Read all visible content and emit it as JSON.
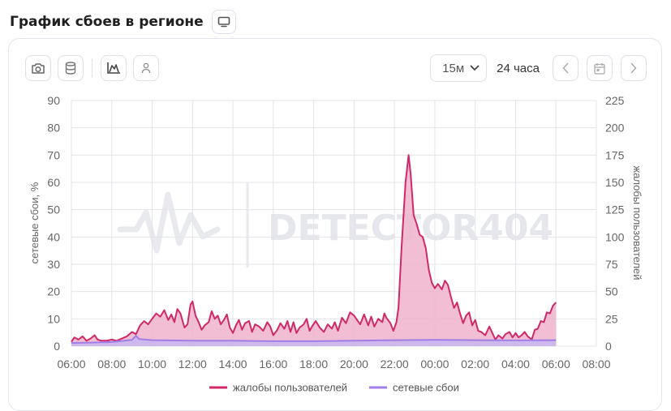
{
  "header": {
    "title": "График сбоев в регионе",
    "screen_icon": "monitor-icon"
  },
  "toolbar": {
    "icons": [
      "camera-icon",
      "database-icon",
      "chart-mode-icon",
      "user-icon"
    ],
    "interval_value": "15м",
    "range_label": "24 часа",
    "prev_icon": "chevron-left-icon",
    "calendar_icon": "calendar-icon",
    "next_icon": "chevron-right-icon"
  },
  "watermark": "DETECTOR404",
  "chart_data": {
    "type": "area",
    "title": "",
    "ylabel_left": "сетевые сбои, %",
    "ylabel_right": "жалобы пользователей",
    "y_left_lim": [
      0,
      90
    ],
    "y_right_lim": [
      0,
      225
    ],
    "y_left_ticks": [
      "0",
      "10",
      "20",
      "30",
      "40",
      "50",
      "60",
      "70",
      "80",
      "90"
    ],
    "y_right_ticks": [
      "0",
      "25",
      "50",
      "75",
      "100",
      "125",
      "150",
      "175",
      "200",
      "225"
    ],
    "x_ticks": [
      "06:00",
      "08:00",
      "10:00",
      "12:00",
      "14:00",
      "16:00",
      "18:00",
      "20:00",
      "22:00",
      "00:00",
      "02:00",
      "04:00",
      "06:00",
      "08:00"
    ],
    "x_hours_lim": [
      0,
      26
    ],
    "grid": true,
    "legend_position": "bottom",
    "series": [
      {
        "name": "жалобы пользователей",
        "axis": "right",
        "color": "#d1286a",
        "fill": "#efb3cb",
        "points": [
          [
            0.0,
            4
          ],
          [
            0.15,
            8
          ],
          [
            0.35,
            6
          ],
          [
            0.55,
            9
          ],
          [
            0.75,
            5
          ],
          [
            0.95,
            7
          ],
          [
            1.15,
            10
          ],
          [
            1.3,
            6
          ],
          [
            1.5,
            5
          ],
          [
            1.75,
            5
          ],
          [
            2.0,
            6
          ],
          [
            2.25,
            5
          ],
          [
            2.5,
            7
          ],
          [
            2.75,
            9
          ],
          [
            3.0,
            13
          ],
          [
            3.2,
            11
          ],
          [
            3.4,
            19
          ],
          [
            3.6,
            23
          ],
          [
            3.8,
            20
          ],
          [
            4.0,
            25
          ],
          [
            4.2,
            30
          ],
          [
            4.4,
            27
          ],
          [
            4.6,
            33
          ],
          [
            4.8,
            24
          ],
          [
            4.95,
            29
          ],
          [
            5.1,
            22
          ],
          [
            5.25,
            34
          ],
          [
            5.4,
            30
          ],
          [
            5.6,
            17
          ],
          [
            5.75,
            20
          ],
          [
            5.9,
            38
          ],
          [
            6.0,
            41
          ],
          [
            6.15,
            28
          ],
          [
            6.3,
            22
          ],
          [
            6.45,
            15
          ],
          [
            6.6,
            19
          ],
          [
            6.8,
            22
          ],
          [
            6.95,
            32
          ],
          [
            7.1,
            25
          ],
          [
            7.25,
            28
          ],
          [
            7.4,
            20
          ],
          [
            7.55,
            24
          ],
          [
            7.7,
            29
          ],
          [
            7.85,
            17
          ],
          [
            8.0,
            12
          ],
          [
            8.15,
            19
          ],
          [
            8.3,
            24
          ],
          [
            8.45,
            15
          ],
          [
            8.6,
            21
          ],
          [
            8.8,
            23
          ],
          [
            8.95,
            13
          ],
          [
            9.1,
            20
          ],
          [
            9.3,
            18
          ],
          [
            9.5,
            14
          ],
          [
            9.7,
            22
          ],
          [
            9.85,
            18
          ],
          [
            10.0,
            10
          ],
          [
            10.2,
            15
          ],
          [
            10.35,
            21
          ],
          [
            10.55,
            16
          ],
          [
            10.7,
            23
          ],
          [
            10.85,
            13
          ],
          [
            11.0,
            22
          ],
          [
            11.15,
            12
          ],
          [
            11.3,
            17
          ],
          [
            11.5,
            20
          ],
          [
            11.65,
            25
          ],
          [
            11.8,
            14
          ],
          [
            11.95,
            19
          ],
          [
            12.1,
            23
          ],
          [
            12.3,
            17
          ],
          [
            12.5,
            13
          ],
          [
            12.7,
            20
          ],
          [
            12.9,
            16
          ],
          [
            13.05,
            22
          ],
          [
            13.2,
            14
          ],
          [
            13.4,
            26
          ],
          [
            13.6,
            21
          ],
          [
            13.8,
            31
          ],
          [
            14.0,
            28
          ],
          [
            14.15,
            24
          ],
          [
            14.3,
            20
          ],
          [
            14.5,
            29
          ],
          [
            14.7,
            19
          ],
          [
            14.85,
            27
          ],
          [
            15.0,
            18
          ],
          [
            15.2,
            25
          ],
          [
            15.4,
            22
          ],
          [
            15.5,
            30
          ],
          [
            15.6,
            26
          ],
          [
            15.8,
            21
          ],
          [
            15.95,
            14
          ],
          [
            16.1,
            22
          ],
          [
            16.2,
            35
          ],
          [
            16.35,
            90
          ],
          [
            16.55,
            150
          ],
          [
            16.7,
            175
          ],
          [
            16.8,
            158
          ],
          [
            16.95,
            120
          ],
          [
            17.1,
            112
          ],
          [
            17.25,
            102
          ],
          [
            17.4,
            100
          ],
          [
            17.55,
            90
          ],
          [
            17.7,
            70
          ],
          [
            17.85,
            58
          ],
          [
            18.0,
            53
          ],
          [
            18.15,
            57
          ],
          [
            18.35,
            52
          ],
          [
            18.5,
            60
          ],
          [
            18.65,
            56
          ],
          [
            18.8,
            45
          ],
          [
            18.95,
            35
          ],
          [
            19.1,
            40
          ],
          [
            19.25,
            30
          ],
          [
            19.4,
            21
          ],
          [
            19.55,
            28
          ],
          [
            19.7,
            31
          ],
          [
            19.85,
            19
          ],
          [
            20.0,
            24
          ],
          [
            20.15,
            14
          ],
          [
            20.3,
            13
          ],
          [
            20.5,
            10
          ],
          [
            20.7,
            18
          ],
          [
            20.85,
            12
          ],
          [
            21.0,
            6
          ],
          [
            21.15,
            10
          ],
          [
            21.35,
            7
          ],
          [
            21.5,
            11
          ],
          [
            21.7,
            13
          ],
          [
            21.85,
            8
          ],
          [
            22.0,
            12
          ],
          [
            22.15,
            8
          ],
          [
            22.3,
            10
          ],
          [
            22.45,
            13
          ],
          [
            22.6,
            9
          ],
          [
            22.8,
            6
          ],
          [
            22.95,
            15
          ],
          [
            23.1,
            16
          ],
          [
            23.25,
            23
          ],
          [
            23.4,
            22
          ],
          [
            23.55,
            31
          ],
          [
            23.7,
            30
          ],
          [
            23.85,
            37
          ],
          [
            24.0,
            40
          ]
        ]
      },
      {
        "name": "сетевые сбои",
        "axis": "left",
        "color": "#a07ee6",
        "fill": "#c9b8ef",
        "points": [
          [
            0.0,
            1.2
          ],
          [
            1.0,
            1.3
          ],
          [
            2.0,
            1.5
          ],
          [
            3.0,
            2.3
          ],
          [
            3.2,
            3.8
          ],
          [
            3.35,
            2.6
          ],
          [
            4.0,
            2.2
          ],
          [
            6.0,
            2.0
          ],
          [
            8.0,
            2.0
          ],
          [
            10.0,
            1.8
          ],
          [
            12.0,
            1.8
          ],
          [
            14.0,
            2.0
          ],
          [
            16.0,
            2.2
          ],
          [
            18.0,
            2.3
          ],
          [
            20.0,
            2.2
          ],
          [
            22.0,
            2.1
          ],
          [
            24.0,
            2.2
          ]
        ]
      }
    ]
  }
}
